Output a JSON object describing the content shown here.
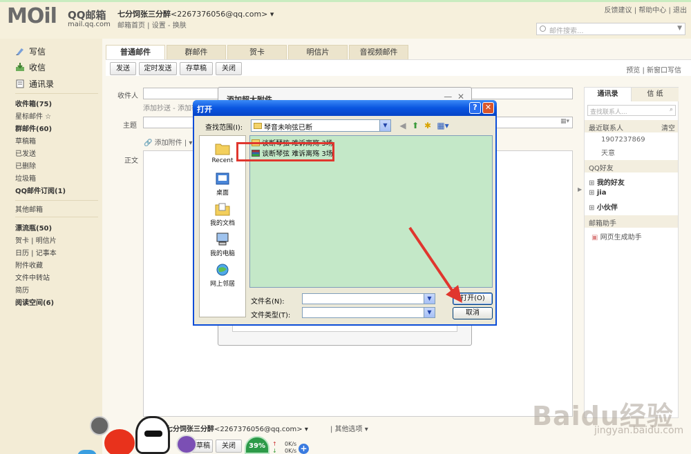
{
  "header": {
    "logo_text": "MOil",
    "logo_brand": "QQ邮箱",
    "logo_url": "mail.qq.com",
    "user_display": "七分饲张三分醉",
    "user_email": "<2267376056@qq.com>",
    "user_links": "邮箱首页 | 设置 - 换肤",
    "top_links": "反馈建议 | 帮助中心 | 退出",
    "search_placeholder": "邮件搜索..."
  },
  "sidebar": {
    "compose": "写信",
    "inbox_big": "收信",
    "contacts": "通讯录",
    "folders": [
      {
        "label": "收件箱(75)",
        "bold": true
      },
      {
        "label": "星标邮件 ☆",
        "bold": false
      },
      {
        "label": "群邮件(60)",
        "bold": true
      },
      {
        "label": "草稿箱",
        "bold": false
      },
      {
        "label": "已发送",
        "bold": false
      },
      {
        "label": "已删除",
        "bold": false
      },
      {
        "label": "垃圾箱",
        "bold": false
      },
      {
        "label": "QQ邮件订阅(1)",
        "bold": true
      }
    ],
    "other": "其他邮箱",
    "extras": [
      {
        "label": "漂流瓶(50)",
        "bold": true
      },
      {
        "label": "贺卡 | 明信片",
        "bold": false
      },
      {
        "label": "日历 | 记事本",
        "bold": false
      },
      {
        "label": "附件收藏",
        "bold": false
      },
      {
        "label": "文件中转站",
        "bold": false
      },
      {
        "label": "简历",
        "bold": false
      },
      {
        "label": "阅读空间(6)",
        "bold": true
      }
    ]
  },
  "tabs": [
    "普通邮件",
    "群邮件",
    "贺卡",
    "明信片",
    "音视频邮件"
  ],
  "toolbar": {
    "send": "发送",
    "timed_send": "定时发送",
    "save_draft": "存草稿",
    "close": "关闭",
    "right_links": "预览 | 新窗口写信"
  },
  "compose": {
    "to_label": "收件人",
    "add_cc": "添加抄送 - 添加密送",
    "subject_label": "主题",
    "attach": "添加附件",
    "body_label": "正文"
  },
  "right_panel": {
    "tab_contacts": "通讯录",
    "tab_paper": "信 纸",
    "search_placeholder": "查找联系人...",
    "recent": "最近联系人",
    "clear": "清空",
    "recent_items": [
      "1907237869",
      "天意"
    ],
    "qq_friends": "QQ好友",
    "groups": [
      "我的好友",
      "jia",
      "小伙伴"
    ],
    "assistant": "邮箱助手",
    "assistant_item": "网页生成助手"
  },
  "bg_dialog": {
    "title": "添加超大附件",
    "minimize": "—",
    "close": "✕"
  },
  "open_dialog": {
    "title": "打开",
    "help": "?",
    "close": "✕",
    "lookin_label": "查找范围(I):",
    "lookin_value": "琴音未响弦已断",
    "places": [
      "Recent",
      "桌面",
      "我的文档",
      "我的电脑",
      "网上邻居"
    ],
    "files": [
      {
        "name": "谈断琴弦 难诉离殇 3场",
        "type": "folder"
      },
      {
        "name": "谈断琴弦 难诉离殇 3场",
        "type": "archive"
      }
    ],
    "filename_label": "文件名(N):",
    "filetype_label": "文件类型(T):",
    "open_btn": "打开(O)",
    "cancel_btn": "取消"
  },
  "bottom": {
    "user_display": "七分饲张三分醉",
    "user_email": "<2267376056@qq.com>",
    "other_options": "其他选项",
    "save_draft": "存草稿",
    "close": "关闭",
    "speed_percent": "39%",
    "speed_up": "0K/s",
    "speed_down": "0K/s"
  },
  "watermark": {
    "main": "Baidu经验",
    "url": "jingyan.baidu.com"
  },
  "colors": {
    "title_bar": "#0a55e0",
    "file_list_bg": "#c4e8c8",
    "highlight": "#e0362e",
    "arrow": "#e0362e",
    "page_bg": "#f3ecd6"
  }
}
